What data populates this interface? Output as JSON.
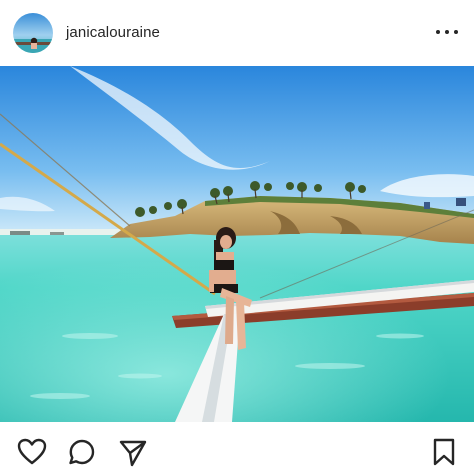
{
  "post": {
    "username": "janicalouraine"
  },
  "photo": {
    "subject": "woman-sitting-on-outrigger-boat",
    "scene": "tropical-island-turquoise-water"
  },
  "icons": {
    "more": "more-options-icon",
    "like": "heart-icon",
    "comment": "comment-bubble-icon",
    "share": "send-paper-plane-icon",
    "save": "bookmark-icon"
  },
  "colors": {
    "text": "#262626",
    "sky_top": "#2f8fe0",
    "sky_bottom": "#bfe3f5",
    "water_light": "#5fdcd0",
    "water_deep": "#1fb3ab",
    "cliff": "#c9a86a"
  }
}
